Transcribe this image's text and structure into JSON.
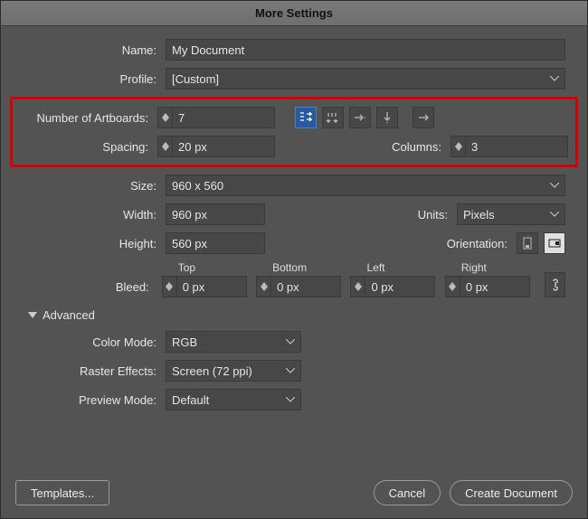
{
  "title": "More Settings",
  "labels": {
    "name": "Name:",
    "profile": "Profile:",
    "numArtboards": "Number of Artboards:",
    "spacing": "Spacing:",
    "columns": "Columns:",
    "size": "Size:",
    "width": "Width:",
    "height": "Height:",
    "units": "Units:",
    "orientation": "Orientation:",
    "bleed": "Bleed:",
    "top": "Top",
    "bottom": "Bottom",
    "left": "Left",
    "right": "Right",
    "advanced": "Advanced",
    "colorMode": "Color Mode:",
    "rasterEffects": "Raster Effects:",
    "previewMode": "Preview Mode:"
  },
  "values": {
    "name": "My Document",
    "profile": "[Custom]",
    "numArtboards": "7",
    "spacing": "20 px",
    "columns": "3",
    "size": "960 x 560",
    "width": "960 px",
    "height": "560 px",
    "units": "Pixels",
    "bleedTop": "0 px",
    "bleedBottom": "0 px",
    "bleedLeft": "0 px",
    "bleedRight": "0 px",
    "colorMode": "RGB",
    "rasterEffects": "Screen (72 ppi)",
    "previewMode": "Default"
  },
  "buttons": {
    "templates": "Templates...",
    "cancel": "Cancel",
    "create": "Create Document"
  }
}
